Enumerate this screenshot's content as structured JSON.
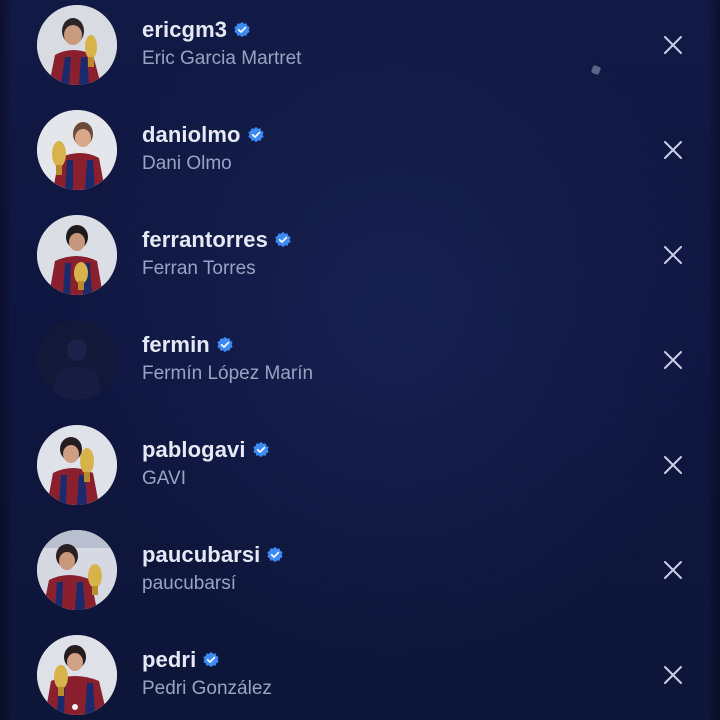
{
  "suggested_accounts": [
    {
      "username": "ericgm3",
      "full_name": "Eric Garcia Martret",
      "verified": true,
      "avatar": "player-photo"
    },
    {
      "username": "daniolmo",
      "full_name": "Dani Olmo",
      "verified": true,
      "avatar": "player-photo"
    },
    {
      "username": "ferrantorres",
      "full_name": "Ferran Torres",
      "verified": true,
      "avatar": "player-photo"
    },
    {
      "username": "fermin",
      "full_name": "Fermín López Marín",
      "verified": true,
      "avatar": "player-photo-dark"
    },
    {
      "username": "pablogavi",
      "full_name": "GAVI",
      "verified": true,
      "avatar": "player-photo"
    },
    {
      "username": "paucubarsi",
      "full_name": "paucubarsí",
      "verified": true,
      "avatar": "player-photo"
    },
    {
      "username": "pedri",
      "full_name": "Pedri González",
      "verified": true,
      "avatar": "player-photo"
    }
  ],
  "icons": {
    "verified": "verified-badge-icon",
    "dismiss": "close-icon"
  },
  "colors": {
    "background": "#0d1538",
    "username": "#e6e9f4",
    "full_name": "#9aa3c2",
    "verified_badge": "#3d8bf5",
    "close": "#c9cfe6"
  }
}
